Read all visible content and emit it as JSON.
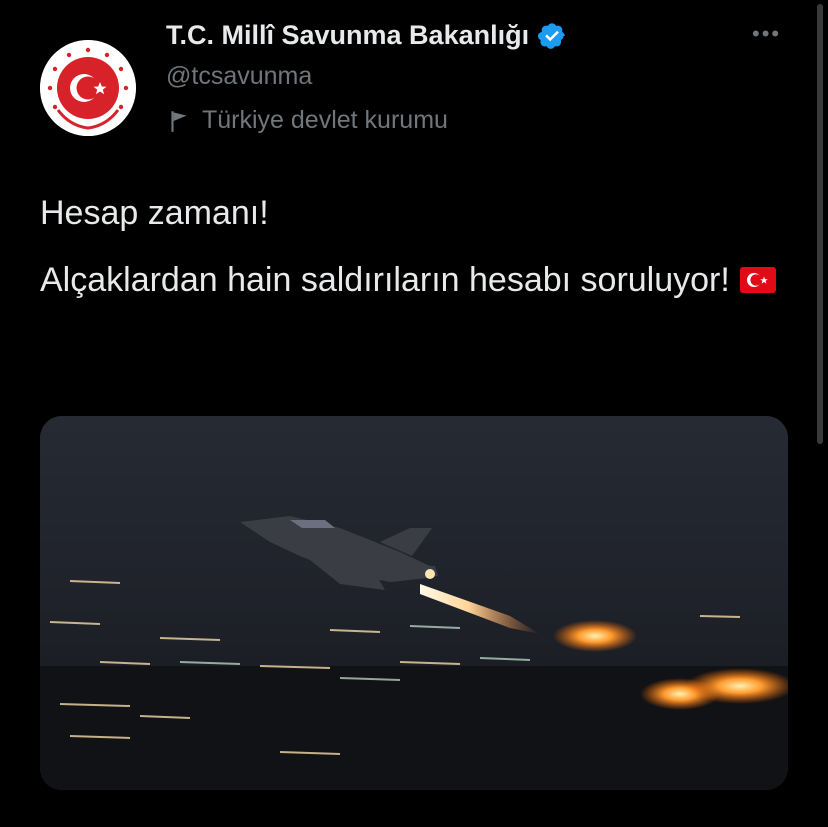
{
  "account": {
    "display_name": "T.C. Millî Savunma Bakanlığı",
    "handle": "@tcsavunma",
    "label": "Türkiye devlet kurumu",
    "verified": true
  },
  "icons": {
    "avatar": "ministry-emblem-icon",
    "verified": "verified-badge-icon",
    "label": "flag-icon",
    "more": "more-options-icon",
    "emoji": "turkey-flag-emoji-icon"
  },
  "tweet": {
    "line1": "Hesap zamanı!",
    "line2": "Alçaklardan hain saldırıların hesabı soruluyor!",
    "emoji": "🇹🇷"
  },
  "media": {
    "description": "photo"
  },
  "colors": {
    "background": "#000000",
    "text": "#e7e9ea",
    "secondary": "#71767b",
    "verified": "#1d9bf0",
    "emblem_red": "#d7222a"
  }
}
